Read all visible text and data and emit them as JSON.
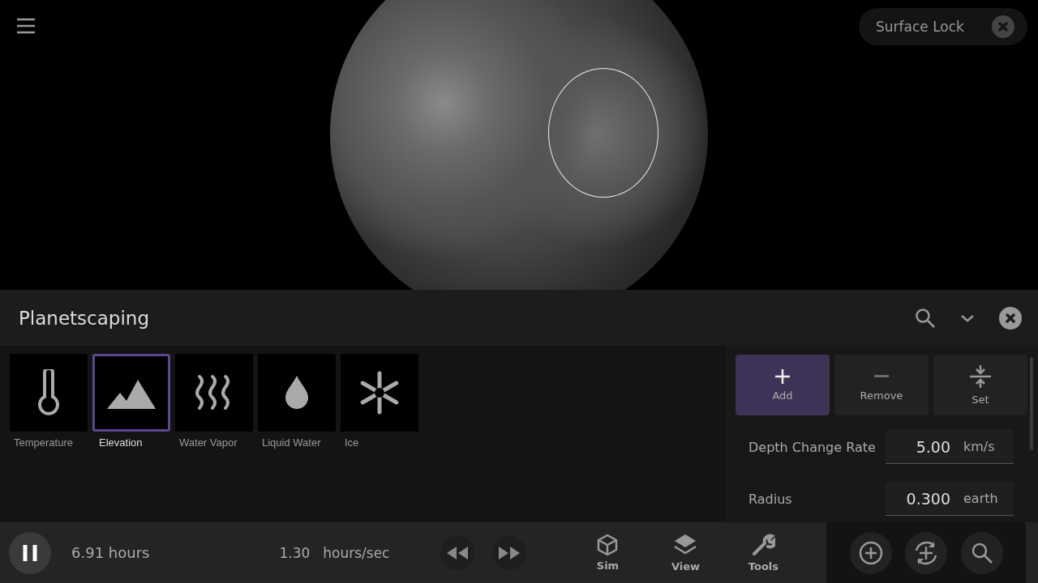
{
  "surface_lock": {
    "label": "Surface Lock"
  },
  "panel": {
    "title": "Planetscaping",
    "layers": [
      {
        "label": "Temperature",
        "kind": "thermometer",
        "selected": false
      },
      {
        "label": "Elevation",
        "kind": "mountain",
        "selected": true
      },
      {
        "label": "Water Vapor",
        "kind": "vapor",
        "selected": false
      },
      {
        "label": "Liquid Water",
        "kind": "drop",
        "selected": false
      },
      {
        "label": "Ice",
        "kind": "snowflake",
        "selected": false
      }
    ],
    "modes": [
      {
        "label": "Add",
        "kind": "plus",
        "selected": true
      },
      {
        "label": "Remove",
        "kind": "minus",
        "selected": false
      },
      {
        "label": "Set",
        "kind": "set",
        "selected": false
      }
    ],
    "fields": [
      {
        "label": "Depth Change Rate",
        "value": "5.00",
        "unit": "km/s"
      },
      {
        "label": "Radius",
        "value": "0.300",
        "unit": "earth"
      }
    ]
  },
  "bottom_bar": {
    "elapsed": "6.91 hours",
    "rate": "1.30",
    "rate_unit": "hours/sec",
    "nav": [
      {
        "label": "Sim",
        "kind": "cube"
      },
      {
        "label": "View",
        "kind": "layers"
      },
      {
        "label": "Tools",
        "kind": "wrench"
      }
    ]
  }
}
